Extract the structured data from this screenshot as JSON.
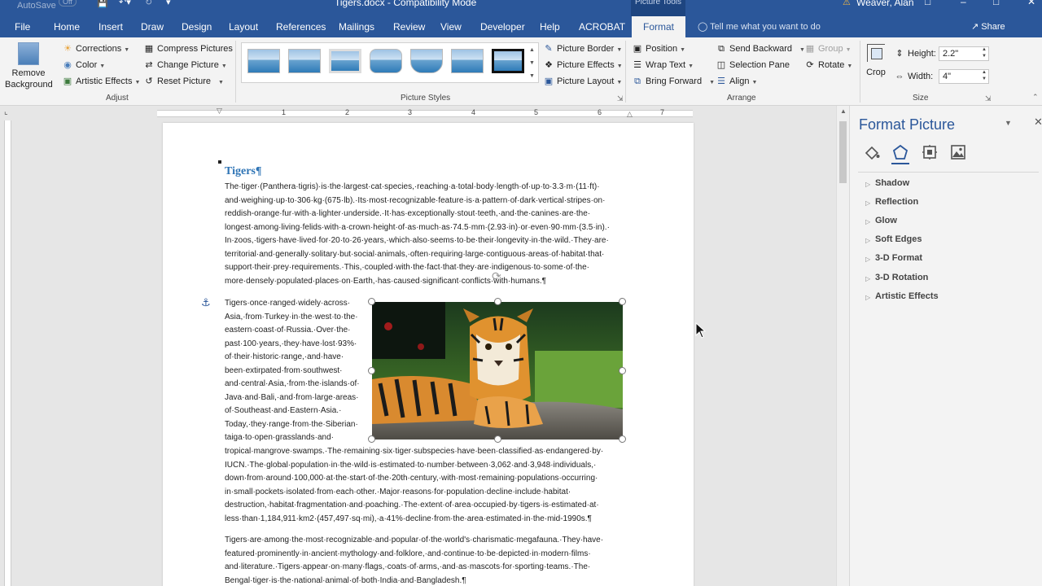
{
  "titlebar": {
    "autosave": "AutoSave",
    "autosave_state": "Off",
    "doc_title": "Tigers.docx  -  Compatibility Mode",
    "context_label": "Picture Tools",
    "user": "Weaver, Alan"
  },
  "tabs": [
    "File",
    "Home",
    "Insert",
    "Draw",
    "Design",
    "Layout",
    "References",
    "Mailings",
    "Review",
    "View",
    "Developer",
    "Help",
    "ACROBAT",
    "Format"
  ],
  "active_tab": "Format",
  "tell_me": "Tell me what you want to do",
  "share": "Share",
  "ribbon": {
    "adjust": {
      "remove_bg_line1": "Remove",
      "remove_bg_line2": "Background",
      "corrections": "Corrections",
      "color": "Color",
      "artistic_effects": "Artistic Effects",
      "compress": "Compress Pictures",
      "change": "Change Picture",
      "reset": "Reset Picture",
      "label": "Adjust"
    },
    "picture_styles": {
      "label": "Picture Styles",
      "border": "Picture Border",
      "effects": "Picture Effects",
      "layout": "Picture Layout"
    },
    "arrange": {
      "position": "Position",
      "wrap_text": "Wrap Text",
      "bring_forward": "Bring Forward",
      "send_backward": "Send Backward",
      "selection_pane": "Selection Pane",
      "align": "Align",
      "group": "Group",
      "rotate": "Rotate",
      "label": "Arrange"
    },
    "size": {
      "crop": "Crop",
      "height_label": "Height:",
      "height_value": "2.2\"",
      "width_label": "Width:",
      "width_value": "4\"",
      "label": "Size"
    }
  },
  "ruler_numbers": [
    "1",
    "2",
    "3",
    "4",
    "5",
    "6",
    "7"
  ],
  "document": {
    "heading": "Tigers¶",
    "p1": [
      "The·tiger·(Panthera·tigris)·is·the·largest·cat·species,·reaching·a·total·body·length·of·up·to·3.3·m·(11·ft)·",
      "and·weighing·up·to·306·kg·(675·lb).·Its·most·recognizable·feature·is·a·pattern·of·dark·vertical·stripes·on·",
      "reddish-orange·fur·with·a·lighter·underside.·It·has·exceptionally·stout·teeth,·and·the·canines·are·the·",
      "longest·among·living·felids·with·a·crown·height·of·as·much·as·74.5·mm·(2.93·in)·or·even·90·mm·(3.5·in).·",
      "In·zoos,·tigers·have·lived·for·20·to·26·years,·which·also·seems·to·be·their·longevity·in·the·wild.·They·are·",
      "territorial·and·generally·solitary·but·social·animals,·often·requiring·large·contiguous·areas·of·habitat·that·",
      "support·their·prey·requirements.·This,·coupled·with·the·fact·that·they·are·indigenous·to·some·of·the·",
      "more·densely·populated·places·on·Earth,·has·caused·significant·conflicts·with·humans.¶"
    ],
    "p2_wrapped": [
      "Tigers·once·ranged·widely·across·",
      "Asia,·from·Turkey·in·the·west·to·the·",
      "eastern·coast·of·Russia.·Over·the·",
      "past·100·years,·they·have·lost·93%·",
      "of·their·historic·range,·and·have·",
      "been·extirpated·from·southwest·",
      "and·central·Asia,·from·the·islands·of·",
      "Java·and·Bali,·and·from·large·areas·",
      "of·Southeast·and·Eastern·Asia.·",
      "Today,·they·range·from·the·Siberian·",
      "taiga·to·open·grasslands·and·"
    ],
    "p2_full": [
      "tropical·mangrove·swamps.·The·remaining·six·tiger·subspecies·have·been·classified·as·endangered·by·",
      "IUCN.·The·global·population·in·the·wild·is·estimated·to·number·between·3,062·and·3,948·individuals,·",
      "down·from·around·100,000·at·the·start·of·the·20th·century,·with·most·remaining·populations·occurring·",
      "in·small·pockets·isolated·from·each·other.·Major·reasons·for·population·decline·include·habitat·",
      "destruction,·habitat·fragmentation·and·poaching.·The·extent·of·area·occupied·by·tigers·is·estimated·at·",
      "less·than·1,184,911·km2·(457,497·sq·mi),·a·41%·decline·from·the·area·estimated·in·the·mid-1990s.¶"
    ],
    "p3": [
      "Tigers·are·among·the·most·recognizable·and·popular·of·the·world's·charismatic·megafauna.·They·have·",
      "featured·prominently·in·ancient·mythology·and·folklore,·and·continue·to·be·depicted·in·modern·films·",
      "and·literature.·Tigers·appear·on·many·flags,·coats·of·arms,·and·as·mascots·for·sporting·teams.·The·",
      "Bengal·tiger·is·the·national·animal·of·both·India·and·Bangladesh.¶"
    ]
  },
  "pane": {
    "title": "Format Picture",
    "tabs": [
      "fill-line-icon",
      "effects-icon",
      "layout-properties-icon",
      "picture-icon"
    ],
    "items": [
      "Shadow",
      "Reflection",
      "Glow",
      "Soft Edges",
      "3-D Format",
      "3-D Rotation",
      "Artistic Effects"
    ]
  },
  "colors": {
    "accent": "#2b579a",
    "heading": "#2e74b5"
  }
}
